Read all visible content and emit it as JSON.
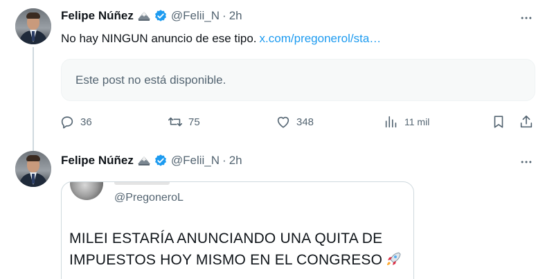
{
  "post1": {
    "author": {
      "name": "Felipe Núñez",
      "handle": "@Felii_N",
      "separator": "·",
      "time": "2h"
    },
    "text": "No hay NINGUN anuncio de ese tipo.",
    "link": "x.com/pregonerol/sta…",
    "unavailable_text": "Este post no está disponible.",
    "actions": {
      "replies": "36",
      "reposts": "75",
      "likes": "348",
      "views": "11 mil"
    }
  },
  "post2": {
    "author": {
      "name": "Felipe Núñez",
      "handle": "@Felii_N",
      "separator": "·",
      "time": "2h"
    },
    "quote": {
      "handle": "@PregoneroL",
      "line1": "MILEI ESTARÍA ANUNCIANDO UNA QUITA DE",
      "line2": "IMPUESTOS HOY MISMO EN EL CONGRESO"
    }
  },
  "icons": {
    "reply": "reply-icon",
    "repost": "repost-icon",
    "like": "heart-icon",
    "views": "views-icon",
    "bookmark": "bookmark-icon",
    "share": "share-icon",
    "more": "more-icon",
    "verified": "verified-badge-icon",
    "eagle": "eagle-emoji-icon",
    "rocket": "rocket-emoji-icon"
  },
  "colors": {
    "link": "#1d9bf0",
    "secondary_text": "#536471",
    "verified": "#1d9bf0"
  }
}
